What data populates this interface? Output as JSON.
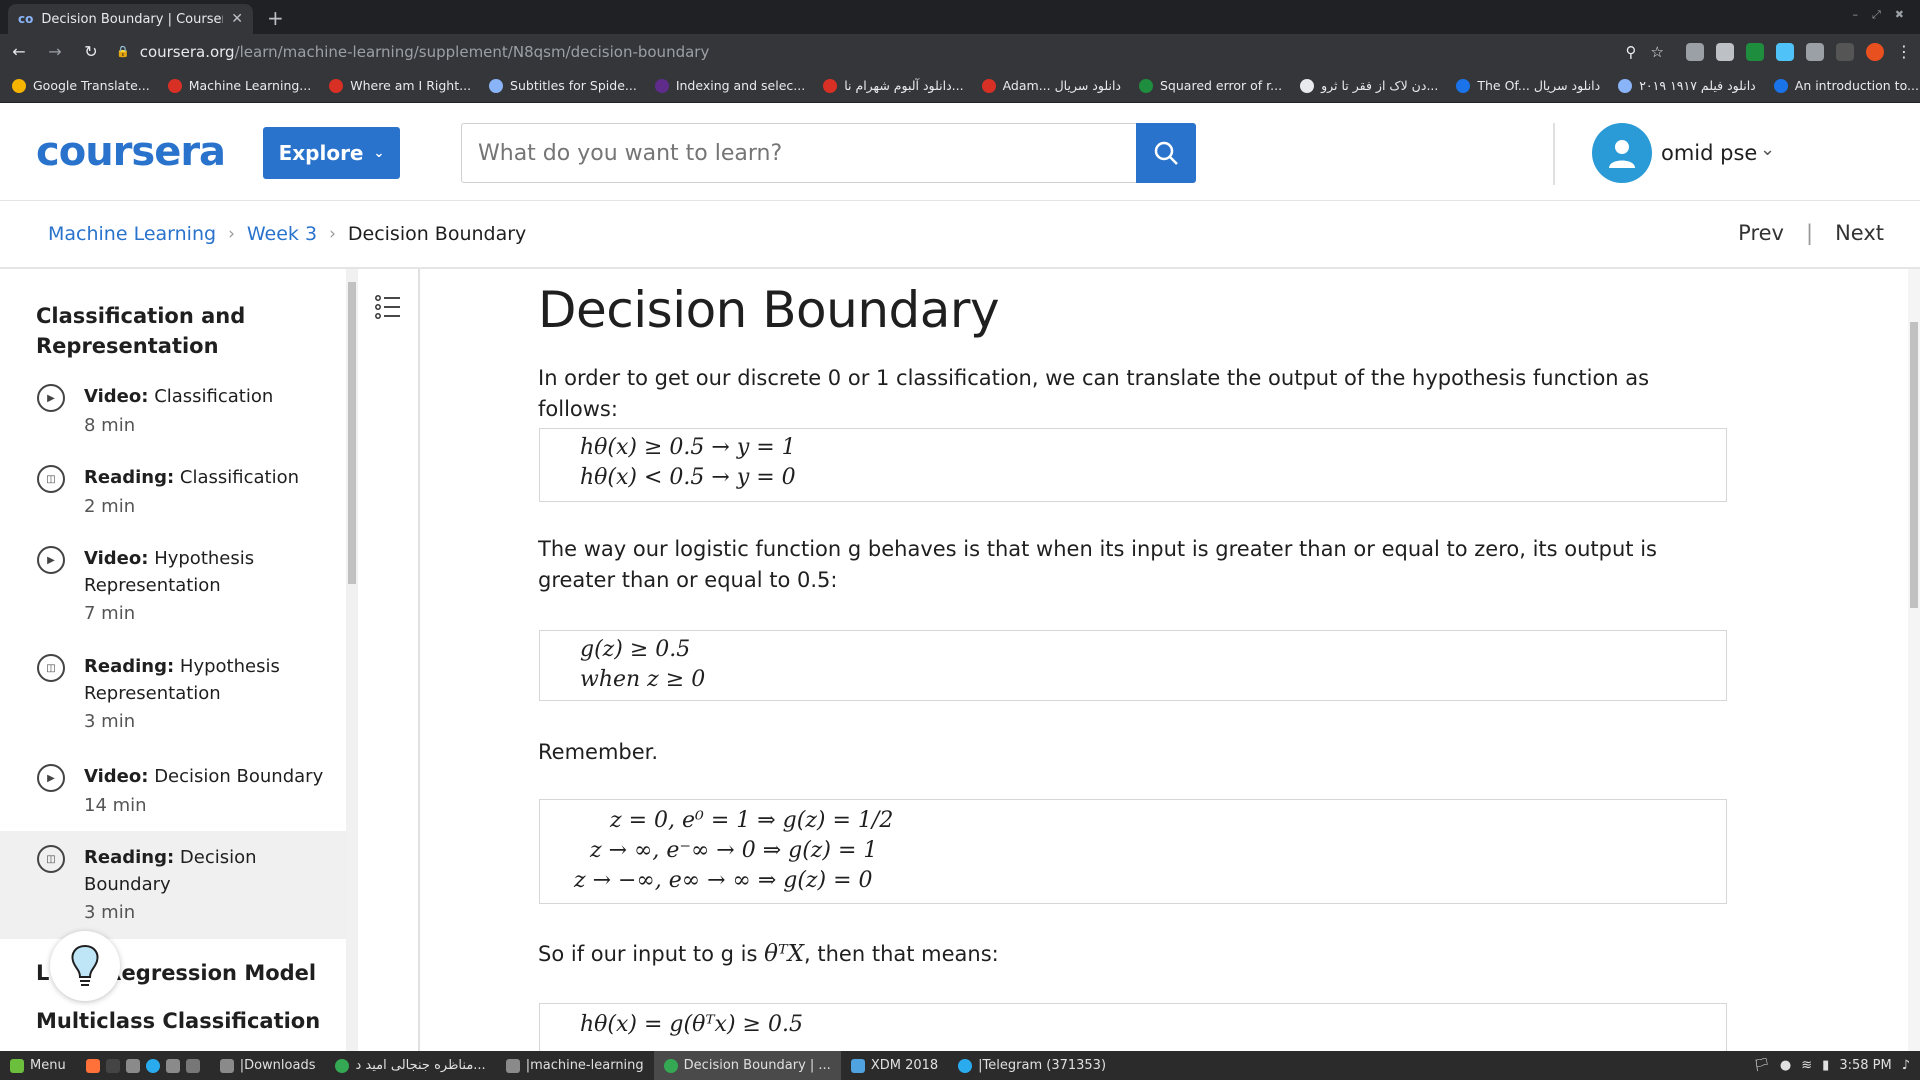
{
  "browser": {
    "tab_title": "Decision Boundary | Coursera",
    "tab_favicon": "co",
    "url_host": "coursera.org",
    "url_path": "/learn/machine-learning/supplement/N8qsm/decision-boundary",
    "bookmarks": [
      {
        "label": "Google Translate...",
        "color": "#f4b400"
      },
      {
        "label": "Machine Learning...",
        "color": "#d93025"
      },
      {
        "label": "Where am I Right...",
        "color": "#d93025"
      },
      {
        "label": "Subtitles for Spide...",
        "color": "#8ab4f8"
      },
      {
        "label": "Indexing and selec...",
        "color": "#5f2c8c"
      },
      {
        "label": "دانلود آلبوم شهرام نا...",
        "color": "#d93025"
      },
      {
        "label": "Adam... دانلود سریال",
        "color": "#d93025"
      },
      {
        "label": "Squared error of r...",
        "color": "#1e8e3e"
      },
      {
        "label": "دن لاک از فقر تا ثرو...",
        "color": "#e8eaed"
      },
      {
        "label": "The Of... دانلود سریال",
        "color": "#1a73e8"
      },
      {
        "label": "دانلود فیلم ۱۹۱۷ ۲۰۱۹",
        "color": "#8ab4f8"
      },
      {
        "label": "An introduction to...",
        "color": "#1a73e8"
      }
    ],
    "bookmarks_more": "»"
  },
  "header": {
    "logo": "coursera",
    "explore_label": "Explore",
    "search_placeholder": "What do you want to learn?",
    "user_name": "omid pse"
  },
  "breadcrumb": {
    "items": [
      "Machine Learning",
      "Week 3",
      "Decision Boundary"
    ],
    "prev": "Prev",
    "next": "Next"
  },
  "sidebar": {
    "section_title": "Classification and Representation",
    "items": [
      {
        "type": "Video:",
        "name": "Classification",
        "duration": "8 min",
        "icon": "play-icon"
      },
      {
        "type": "Reading:",
        "name": "Classification",
        "duration": "2 min",
        "icon": "book-icon"
      },
      {
        "type": "Video:",
        "name": "Hypothesis Representation",
        "duration": "7 min",
        "icon": "play-icon"
      },
      {
        "type": "Reading:",
        "name": "Hypothesis Representation",
        "duration": "3 min",
        "icon": "book-icon"
      },
      {
        "type": "Video:",
        "name": "Decision Boundary",
        "duration": "14 min",
        "icon": "play-icon"
      },
      {
        "type": "Reading:",
        "name": "Decision Boundary",
        "duration": "3 min",
        "icon": "book-icon"
      }
    ],
    "next_section_a": "L",
    "next_section_b": "Regression Model",
    "next_section_c": "Multiclass Classification"
  },
  "content": {
    "title": "Decision Boundary",
    "p1": "In order to get our discrete 0 or 1 classification, we can translate the output of the hypothesis function as follows:",
    "eq1": [
      "hθ(x) ≥ 0.5 → y = 1",
      "hθ(x) < 0.5 → y = 0"
    ],
    "p2": "The way our logistic function g behaves is that when its input is greater than or equal to zero, its output is greater than or equal to 0.5:",
    "eq2": [
      "g(z) ≥ 0.5",
      "when z ≥ 0"
    ],
    "p3": "Remember.",
    "eq3": [
      "z = 0, e⁰ = 1 ⇒ g(z) = 1/2",
      "z → ∞, e⁻∞ → 0 ⇒ g(z) = 1",
      "z → −∞, e∞ → ∞ ⇒ g(z) = 0"
    ],
    "p4_pre": "So if our input to g is ",
    "p4_math": "θᵀX",
    "p4_post": ", then that means:",
    "eq4": [
      "hθ(x) = g(θᵀx) ≥ 0.5"
    ]
  },
  "taskbar": {
    "menu": "Menu",
    "items": [
      "|Downloads",
      "مناظره جنجالی امید د...",
      "|machine-learning",
      "Decision Boundary | ...",
      "XDM 2018",
      "|Telegram (371353)"
    ],
    "clock": "3:58 PM"
  },
  "colors": {
    "brand": "#2a73cc",
    "avatar": "#2a9bd6"
  }
}
